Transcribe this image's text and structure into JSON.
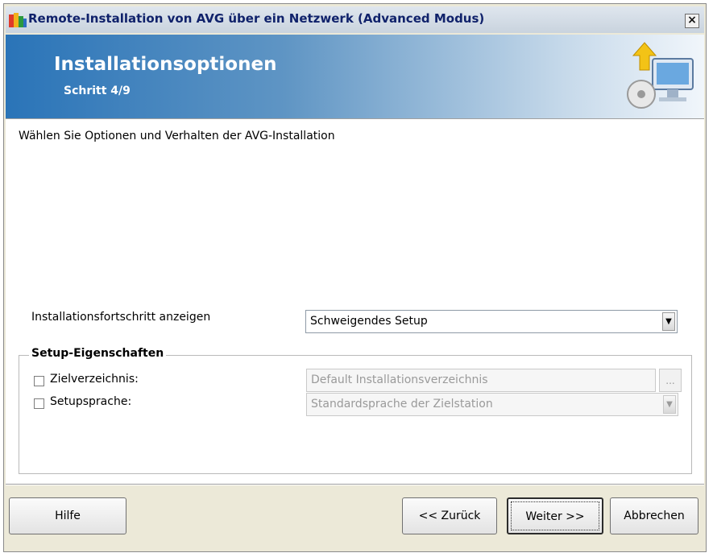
{
  "window": {
    "title": "Remote-Installation von AVG über ein Netzwerk (Advanced Modus)",
    "close_label": "×"
  },
  "banner": {
    "title": "Installationsoptionen",
    "step": "Schritt 4/9",
    "icon": "computer-install-icon"
  },
  "content": {
    "description": "Wählen Sie Optionen und Verhalten der AVG-Installation",
    "progress": {
      "label": "Installationsfortschritt anzeigen",
      "selected": "Schweigendes Setup"
    },
    "setup_properties": {
      "legend": "Setup-Eigenschaften",
      "target_dir": {
        "label": "Zielverzeichnis:",
        "checked": false,
        "value": "Default Installationsverzeichnis",
        "browse_label": "..."
      },
      "setup_language": {
        "label": "Setupsprache:",
        "checked": false,
        "value": "Standardsprache der Zielstation"
      }
    }
  },
  "buttons": {
    "help": "Hilfe",
    "back": "<< Zurück",
    "next": "Weiter >>",
    "cancel": "Abbrechen"
  },
  "colors": {
    "banner_start": "#2a74b8",
    "banner_end": "#f1f6fb",
    "title_text": "#10226b",
    "window_bg": "#ece9d8"
  }
}
